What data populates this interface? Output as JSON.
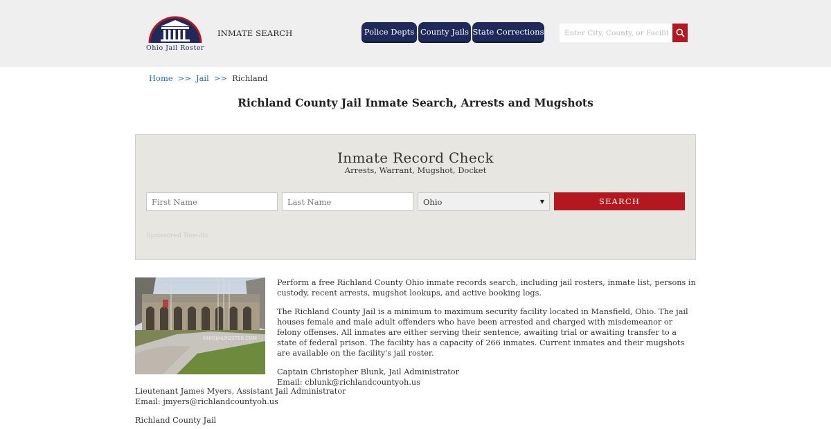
{
  "header": {
    "logo_text": "Ohio Jail Roster",
    "inmate_search": "INMATE SEARCH",
    "nav": [
      "Police Depts",
      "County Jails",
      "State Corrections"
    ],
    "search_placeholder": "Enter City, County, or Facility"
  },
  "breadcrumb": {
    "home": "Home",
    "sep": ">>",
    "jail": "Jail",
    "current": "Richland"
  },
  "page_title": "Richland County Jail Inmate Search, Arrests and Mugshots",
  "record_check": {
    "title": "Inmate Record Check",
    "subtitle": "Arrests, Warrant, Mugshot, Docket",
    "first_placeholder": "First Name",
    "last_placeholder": "Last Name",
    "state": "Ohio",
    "button": "SEARCH",
    "sponsored": "Sponsored Results"
  },
  "photo": {
    "watermark": "OHIOJAILROSTER.COM"
  },
  "content": {
    "p1": "Perform a free Richland County Ohio inmate records search, including jail rosters, inmate list, persons in custody, recent arrests, mugshot lookups, and active booking logs.",
    "p2": "The Richland County Jail is a minimum to maximum security facility located in Mansfield, Ohio. The jail houses female and male adult offenders who have been arrested and charged with misdemeanor or felony offenses. All inmates are either serving their sentence, awaiting trial or awaiting transfer to a state of federal prison. The facility has a capacity of 266 inmates. Current inmates and their mugshots are available on the facility's jail roster.",
    "admin_name": "Captain Christopher Blunk, Jail Administrator",
    "admin_email": "Email: cblunk@richlandcountyoh.us",
    "asst_name": "Lieutenant James Myers, Assistant Jail Administrator",
    "asst_email": "Email: jmyers@richlandcountyoh.us",
    "facility": "Richland County Jail"
  },
  "colors": {
    "navy": "#1f2a5a",
    "red": "#b2181f",
    "link": "#2b6cb0",
    "panel": "#e7e6e1"
  }
}
